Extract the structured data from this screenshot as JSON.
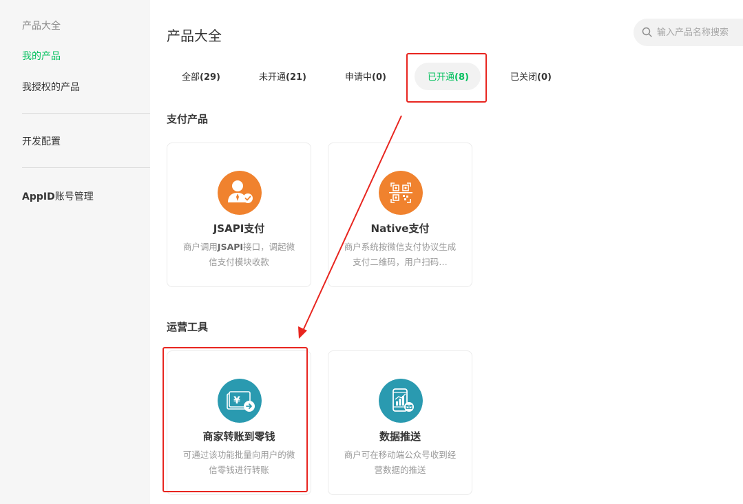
{
  "sidebar": {
    "items": [
      {
        "label": "产品大全"
      },
      {
        "label": "我的产品"
      },
      {
        "label": "我授权的产品"
      },
      {
        "label": "开发配置"
      },
      {
        "label_bold": "AppID",
        "label_rest": "账号管理"
      }
    ]
  },
  "header": {
    "title": "产品大全",
    "search_placeholder": "输入产品名称搜索"
  },
  "tabs": [
    {
      "label": "全部",
      "count": "(29)"
    },
    {
      "label": "未开通",
      "count": "(21)"
    },
    {
      "label": "申请中",
      "count": "(0)"
    },
    {
      "label": "已开通",
      "count": "(8)"
    },
    {
      "label": "已关闭",
      "count": "(0)"
    }
  ],
  "sections": [
    {
      "title": "支付产品",
      "cards": [
        {
          "name": "JSAPI支付",
          "desc_pre": "商户调用",
          "desc_bold": "JSAPI",
          "desc_post": "接口，调起微信支付模块收款",
          "icon": "user-check-icon",
          "icon_color": "#f0822e"
        },
        {
          "name": "Native支付",
          "desc": "商户系统按微信支付协议生成支付二维码，用户扫码…",
          "icon": "qrcode-icon",
          "icon_color": "#f0822e"
        }
      ]
    },
    {
      "title": "运营工具",
      "cards": [
        {
          "name": "商家转账到零钱",
          "desc": "可通过该功能批量向用户的微信零钱进行转账",
          "icon": "money-transfer-icon",
          "icon_color": "#2a9ab0"
        },
        {
          "name": "数据推送",
          "desc": "商户可在移动端公众号收到经营数据的推送",
          "icon": "phone-chart-icon",
          "icon_color": "#2a9ab0"
        }
      ]
    }
  ],
  "colors": {
    "accent_green": "#07c160",
    "highlight_red": "#e8251f",
    "icon_orange": "#f0822e",
    "icon_teal": "#2a9ab0"
  }
}
